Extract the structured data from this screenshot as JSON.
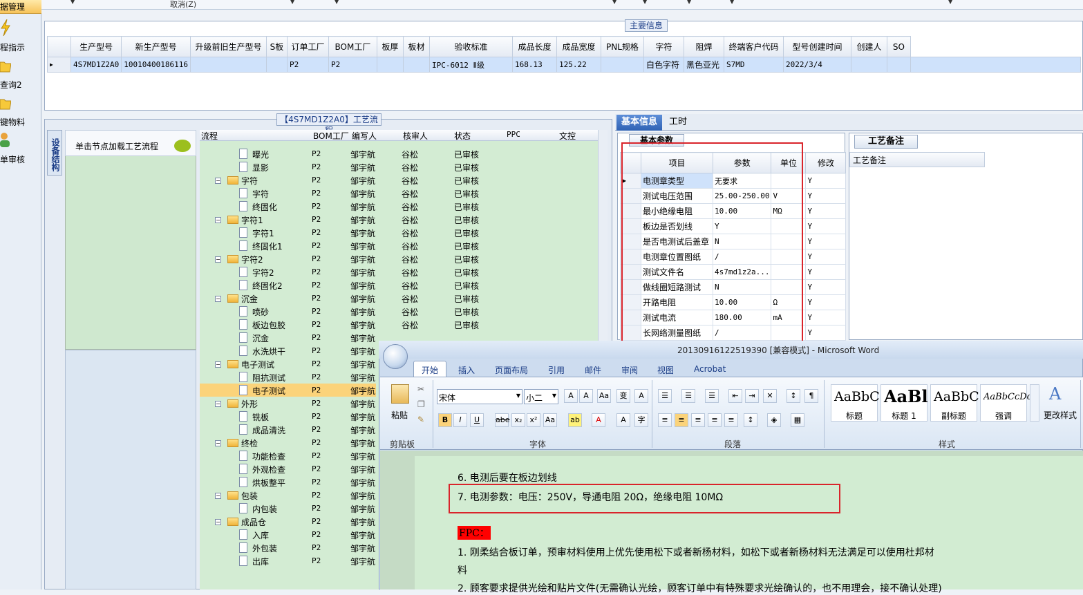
{
  "leftnav": {
    "header": "据管理",
    "items": [
      {
        "label": "程指示",
        "icon": "lightning-icon"
      },
      {
        "label": "查询2",
        "icon": "folder-icon"
      },
      {
        "label": "键物料",
        "icon": "folder-icon"
      },
      {
        "label": "单审核",
        "icon": "user-icon"
      }
    ]
  },
  "topstrip": {
    "cancel_label": "取消(Z)"
  },
  "maininfo": {
    "title": "主要信息",
    "columns": [
      "生产型号",
      "新生产型号",
      "升级前旧生产型号",
      "S板",
      "订单工厂",
      "BOM工厂",
      "板厚",
      "板材",
      "验收标准",
      "成品长度",
      "成品宽度",
      "PNL规格",
      "字符",
      "阻焊",
      "终端客户代码",
      "型号创建时间",
      "创建人",
      "SO"
    ],
    "row": [
      "4S7MD1Z2A0",
      "10010400186116",
      "",
      "",
      "P2",
      "P2",
      "",
      "",
      "IPC-6012 Ⅱ级",
      "168.13",
      "125.22",
      "",
      "白色字符",
      "黑色亚光",
      "S7MD",
      "2022/3/4",
      "",
      ""
    ]
  },
  "flow": {
    "title": "【4S7MD1Z2A0】工艺流程",
    "vtab": "设备结构",
    "sidebox_text": "单击节点加载工艺流程",
    "columns": [
      "流程",
      "BOM工厂",
      "编写人",
      "核审人",
      "状态",
      "PPC",
      "文控"
    ],
    "rows": [
      {
        "name": "曝光",
        "level": 2,
        "bom": "P2",
        "writer": "邹宇航",
        "reviewer": "谷松",
        "status": "已审核"
      },
      {
        "name": "显影",
        "level": 2,
        "bom": "P2",
        "writer": "邹宇航",
        "reviewer": "谷松",
        "status": "已审核"
      },
      {
        "name": "字符",
        "level": 1,
        "bom": "P2",
        "writer": "邹宇航",
        "reviewer": "谷松",
        "status": "已审核"
      },
      {
        "name": "字符",
        "level": 2,
        "bom": "P2",
        "writer": "邹宇航",
        "reviewer": "谷松",
        "status": "已审核"
      },
      {
        "name": "终固化",
        "level": 2,
        "bom": "P2",
        "writer": "邹宇航",
        "reviewer": "谷松",
        "status": "已审核"
      },
      {
        "name": "字符1",
        "level": 1,
        "bom": "P2",
        "writer": "邹宇航",
        "reviewer": "谷松",
        "status": "已审核"
      },
      {
        "name": "字符1",
        "level": 2,
        "bom": "P2",
        "writer": "邹宇航",
        "reviewer": "谷松",
        "status": "已审核"
      },
      {
        "name": "终固化1",
        "level": 2,
        "bom": "P2",
        "writer": "邹宇航",
        "reviewer": "谷松",
        "status": "已审核"
      },
      {
        "name": "字符2",
        "level": 1,
        "bom": "P2",
        "writer": "邹宇航",
        "reviewer": "谷松",
        "status": "已审核"
      },
      {
        "name": "字符2",
        "level": 2,
        "bom": "P2",
        "writer": "邹宇航",
        "reviewer": "谷松",
        "status": "已审核"
      },
      {
        "name": "终固化2",
        "level": 2,
        "bom": "P2",
        "writer": "邹宇航",
        "reviewer": "谷松",
        "status": "已审核"
      },
      {
        "name": "沉金",
        "level": 1,
        "bom": "P2",
        "writer": "邹宇航",
        "reviewer": "谷松",
        "status": "已审核"
      },
      {
        "name": "喷砂",
        "level": 2,
        "bom": "P2",
        "writer": "邹宇航",
        "reviewer": "谷松",
        "status": "已审核"
      },
      {
        "name": "板边包胶",
        "level": 2,
        "bom": "P2",
        "writer": "邹宇航",
        "reviewer": "谷松",
        "status": "已审核"
      },
      {
        "name": "沉金",
        "level": 2,
        "bom": "P2",
        "writer": "邹宇航",
        "reviewer": "",
        "status": ""
      },
      {
        "name": "水洗烘干",
        "level": 2,
        "bom": "P2",
        "writer": "邹宇航",
        "reviewer": "",
        "status": ""
      },
      {
        "name": "电子测试",
        "level": 1,
        "bom": "P2",
        "writer": "邹宇航",
        "reviewer": "",
        "status": ""
      },
      {
        "name": "阻抗测试",
        "level": 2,
        "bom": "P2",
        "writer": "邹宇航",
        "reviewer": "",
        "status": ""
      },
      {
        "name": "电子测试",
        "level": 2,
        "bom": "P2",
        "writer": "邹宇航",
        "reviewer": "",
        "status": "",
        "selected": true
      },
      {
        "name": "外形",
        "level": 1,
        "bom": "P2",
        "writer": "邹宇航",
        "reviewer": "",
        "status": ""
      },
      {
        "name": "铣板",
        "level": 2,
        "bom": "P2",
        "writer": "邹宇航",
        "reviewer": "",
        "status": ""
      },
      {
        "name": "成品清洗",
        "level": 2,
        "bom": "P2",
        "writer": "邹宇航",
        "reviewer": "",
        "status": ""
      },
      {
        "name": "终检",
        "level": 1,
        "bom": "P2",
        "writer": "邹宇航",
        "reviewer": "",
        "status": ""
      },
      {
        "name": "功能检查",
        "level": 2,
        "bom": "P2",
        "writer": "邹宇航",
        "reviewer": "",
        "status": ""
      },
      {
        "name": "外观检查",
        "level": 2,
        "bom": "P2",
        "writer": "邹宇航",
        "reviewer": "",
        "status": ""
      },
      {
        "name": "烘板整平",
        "level": 2,
        "bom": "P2",
        "writer": "邹宇航",
        "reviewer": "",
        "status": ""
      },
      {
        "name": "包装",
        "level": 1,
        "bom": "P2",
        "writer": "邹宇航",
        "reviewer": "",
        "status": ""
      },
      {
        "name": "内包装",
        "level": 2,
        "bom": "P2",
        "writer": "邹宇航",
        "reviewer": "",
        "status": ""
      },
      {
        "name": "成品仓",
        "level": 1,
        "bom": "P2",
        "writer": "邹宇航",
        "reviewer": "",
        "status": ""
      },
      {
        "name": "入库",
        "level": 2,
        "bom": "P2",
        "writer": "邹宇航",
        "reviewer": "",
        "status": ""
      },
      {
        "name": "外包装",
        "level": 2,
        "bom": "P2",
        "writer": "邹宇航",
        "reviewer": "",
        "status": ""
      },
      {
        "name": "出库",
        "level": 2,
        "bom": "P2",
        "writer": "邹宇航",
        "reviewer": "",
        "status": ""
      }
    ]
  },
  "right": {
    "tab_basic": "基本信息",
    "tab_hours": "工时",
    "basic_title": "基本参数",
    "columns": [
      "项目",
      "参数",
      "单位",
      "修改"
    ],
    "rows": [
      {
        "item": "电测章类型",
        "param": "无要求",
        "unit": "",
        "mod": "Y"
      },
      {
        "item": "测试电压范围",
        "param": "25.00-250.00",
        "unit": "V",
        "mod": "Y"
      },
      {
        "item": "最小绝缘电阻",
        "param": "10.00",
        "unit": "MΩ",
        "mod": "Y"
      },
      {
        "item": "板边是否划线",
        "param": "Y",
        "unit": "",
        "mod": "Y"
      },
      {
        "item": "是否电测试后盖章",
        "param": "N",
        "unit": "",
        "mod": "Y"
      },
      {
        "item": "电测章位置图纸",
        "param": "/",
        "unit": "",
        "mod": "Y"
      },
      {
        "item": "测试文件名",
        "param": "4s7md1z2a...",
        "unit": "",
        "mod": "Y"
      },
      {
        "item": "做线圈短路测试",
        "param": "N",
        "unit": "",
        "mod": "Y"
      },
      {
        "item": "开路电阻",
        "param": "10.00",
        "unit": "Ω",
        "mod": "Y"
      },
      {
        "item": "测试电流",
        "param": "180.00",
        "unit": "mA",
        "mod": "Y"
      },
      {
        "item": "长网络测量图纸",
        "param": "/",
        "unit": "",
        "mod": "Y"
      }
    ],
    "note_title": "工艺备注",
    "note_header": "工艺备注"
  },
  "word": {
    "title": "20130916122519390 [兼容模式] - Microsoft Word",
    "tabs": [
      "开始",
      "插入",
      "页面布局",
      "引用",
      "邮件",
      "审阅",
      "视图",
      "Acrobat"
    ],
    "paste_label": "粘贴",
    "font_name": "宋体",
    "font_size": "小二",
    "groups": [
      "剪贴板",
      "字体",
      "段落",
      "样式"
    ],
    "styles": [
      {
        "sample": "AaBbC",
        "label": "标题"
      },
      {
        "sample": "AaBl",
        "label": "标题 1"
      },
      {
        "sample": "AaBbC",
        "label": "副标题"
      },
      {
        "sample": "AaBbCcDc",
        "label": "强调"
      }
    ],
    "change_styles": "更改样式",
    "lines": [
      "6.   电测后要在板边划线",
      "7.   电测参数：电压：250V，导通电阻 20Ω，绝缘电阻 10MΩ",
      "FPC：",
      "1.  刚柔结合板订单，预审材料使用上优先使用松下或者新杨材料，如松下或者新杨材料无法满足可以使用杜邦材",
      "料",
      "2.  顾客要求提供光绘和贴片文件(无需确认光绘，顾客订单中有特殊要求光绘确认的，也不用理会，接不确认处理)"
    ]
  }
}
